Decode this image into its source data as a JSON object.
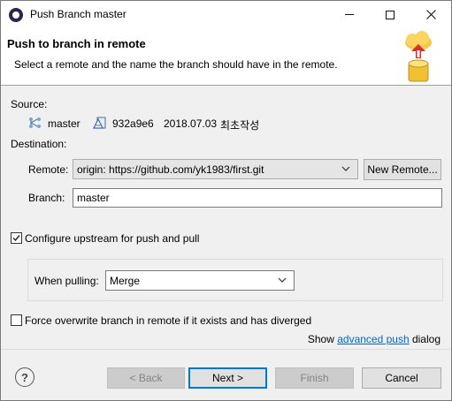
{
  "window": {
    "title": "Push Branch master",
    "controls": {
      "minimize": "minimize-icon",
      "maximize": "maximize-icon",
      "close": "close-icon"
    }
  },
  "header": {
    "title": "Push to branch in remote",
    "description": "Select a remote and the name the branch should have in the remote."
  },
  "source": {
    "label": "Source:",
    "branch_name": "master",
    "commit": "932a9e6",
    "date": "2018.07.03",
    "message": "최초작성"
  },
  "destination": {
    "label": "Destination:",
    "remote_label": "Remote:",
    "remote_value": "origin: https://github.com/yk1983/first.git",
    "new_remote_button": "New Remote...",
    "branch_label": "Branch:",
    "branch_value": "master"
  },
  "upstream": {
    "checkbox_label": "Configure upstream for push and pull",
    "checked": true,
    "pulling_label": "When pulling:",
    "pulling_value": "Merge"
  },
  "force": {
    "checkbox_label": "Force overwrite branch in remote if it exists and has diverged",
    "checked": false
  },
  "advanced": {
    "prefix": "Show",
    "link": "advanced push",
    "suffix": "dialog"
  },
  "buttons": {
    "back": "< Back",
    "next": "Next >",
    "finish": "Finish",
    "cancel": "Cancel"
  },
  "help_glyph": "?",
  "colors": {
    "accent": "#0078d7",
    "link": "#0066cc",
    "dialog_bg": "#f0f0f0"
  }
}
